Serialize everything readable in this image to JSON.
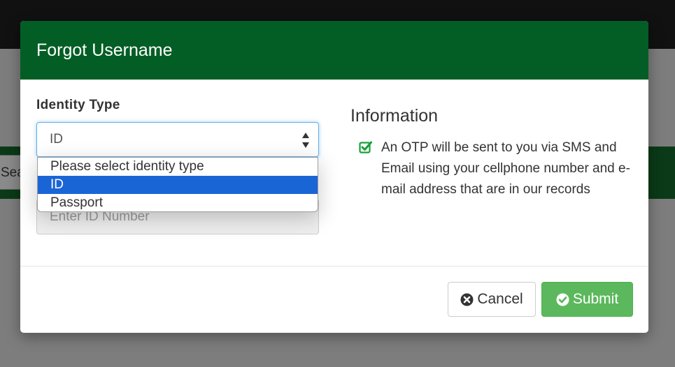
{
  "background": {
    "search_button_label": "Search"
  },
  "modal": {
    "title": "Forgot Username",
    "identity_type": {
      "label": "Identity Type",
      "selected_value": "ID",
      "options": [
        "Please select identity type",
        "ID",
        "Passport"
      ],
      "highlighted_option": "ID"
    },
    "id_number": {
      "placeholder": "Enter ID Number"
    },
    "information": {
      "title": "Information",
      "text": "An OTP will be sent to you via SMS and Email using your cellphone number and e-mail address that are in our records"
    },
    "buttons": {
      "cancel_label": "Cancel",
      "submit_label": "Submit"
    }
  },
  "colors": {
    "header_green": "#035e25",
    "submit_green": "#5cb85c",
    "selected_option_blue": "#1a65d6",
    "check_icon_green": "#18a03a"
  },
  "icons": {
    "select": "up-down-arrows-icon",
    "info": "checked-square-icon",
    "cancel": "times-circle-icon",
    "submit": "check-circle-icon"
  }
}
